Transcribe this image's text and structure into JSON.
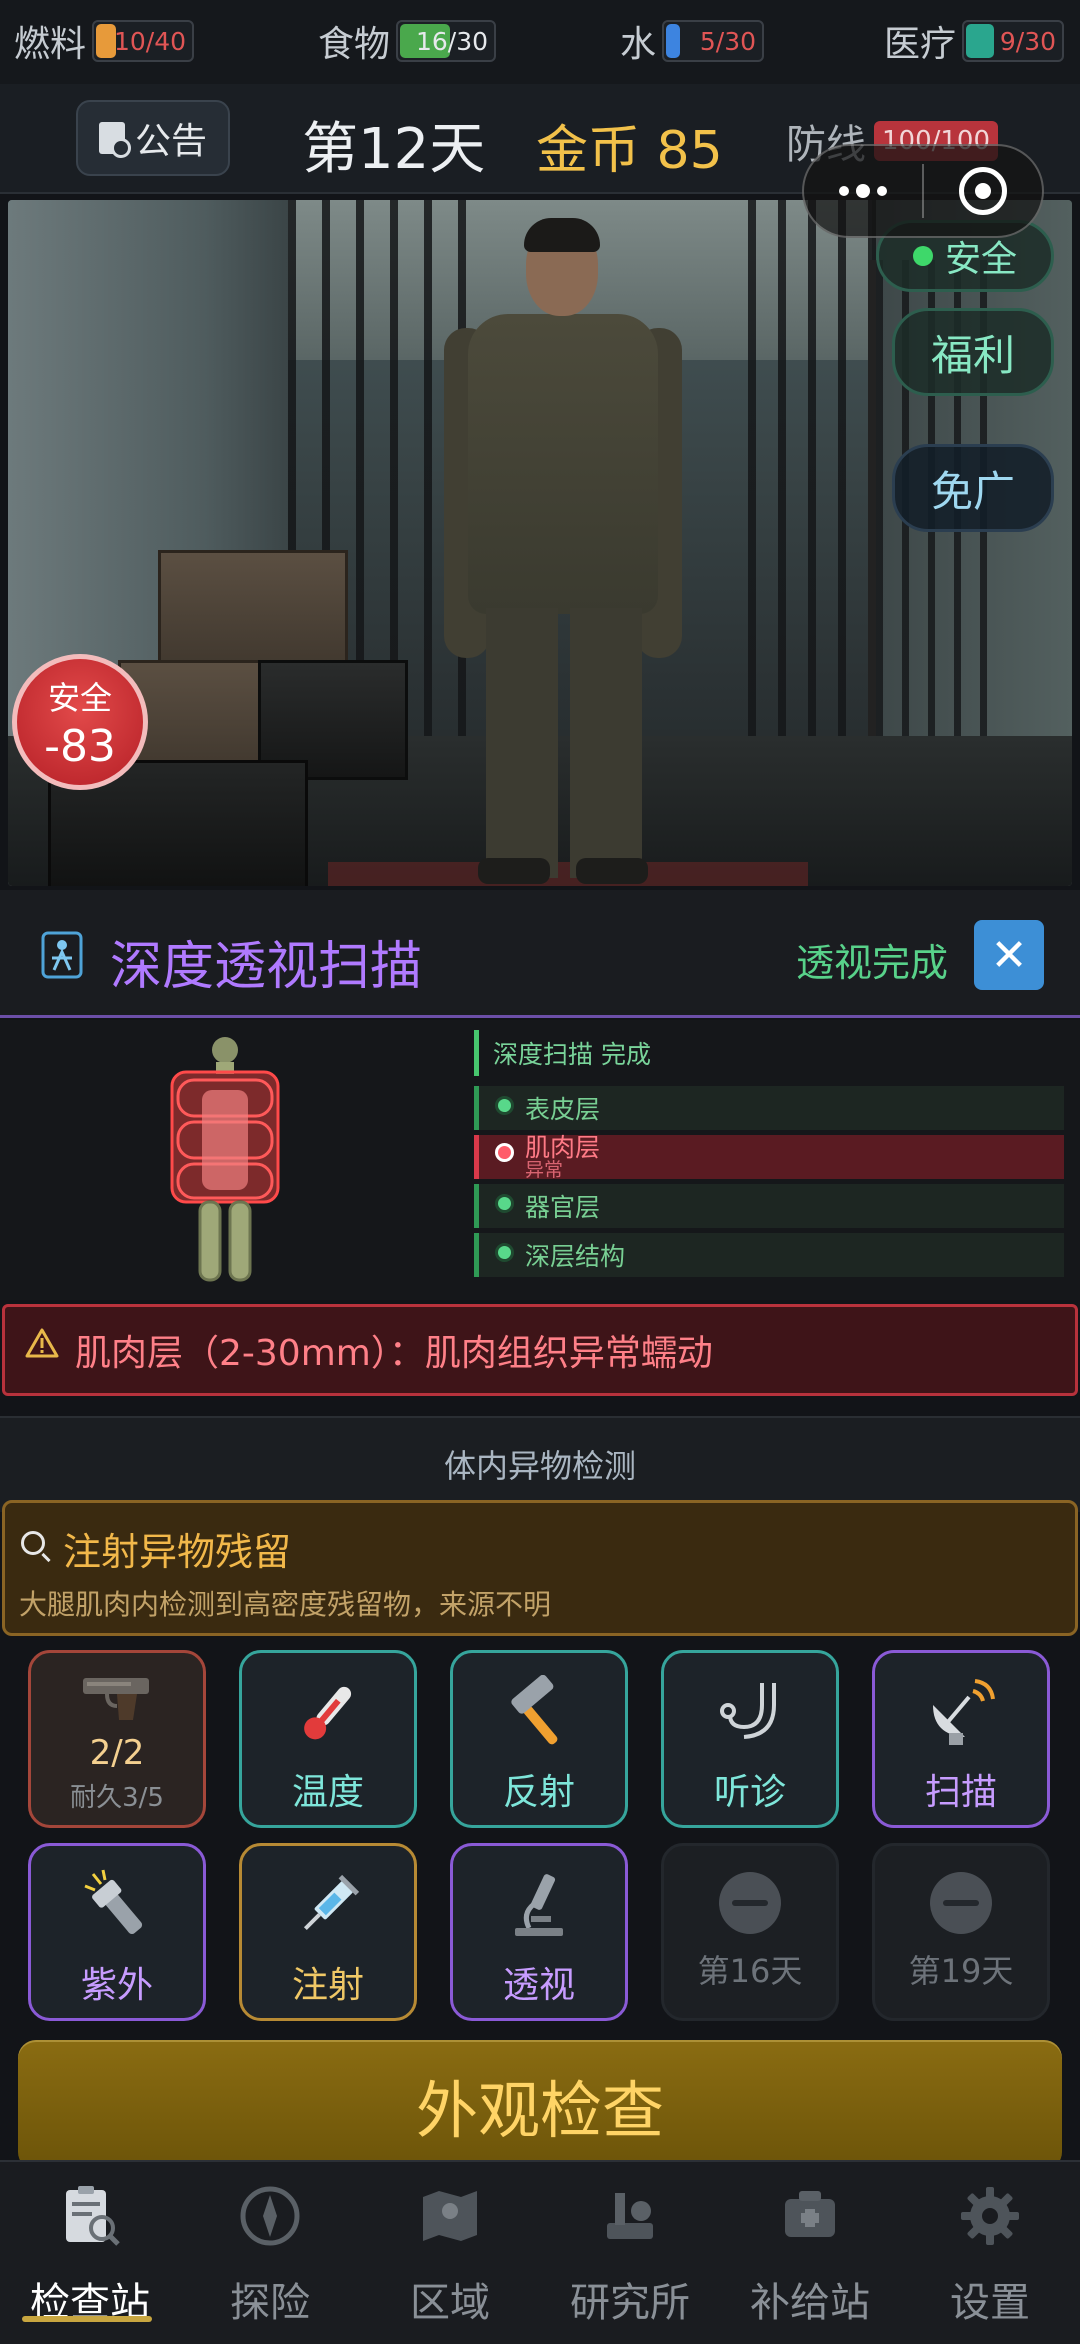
{
  "resources": [
    {
      "label": "燃料",
      "value": "10/40",
      "color": "#e79a3a",
      "value_color": "#e05555"
    },
    {
      "label": "食物",
      "value": "16/30",
      "color": "#4aa84c",
      "value_color": "#e6e9ec"
    },
    {
      "label": "水",
      "value": "5/30",
      "color": "#3d84e0",
      "value_color": "#e05555"
    },
    {
      "label": "医疗",
      "value": "9/30",
      "color": "#2aa68e",
      "value_color": "#e05555"
    }
  ],
  "status": {
    "notice_label": "公告",
    "day": "第12天",
    "gold": "金币 85",
    "defense_label": "防线",
    "defense_value": "100/100"
  },
  "scene": {
    "safe_chip": "安全",
    "welfare_button": "福利",
    "no_ads_button": "免广",
    "danger_label": "安全",
    "danger_value": "-83"
  },
  "scan": {
    "title": "深度透视扫描",
    "status": "透视完成",
    "close": "✕",
    "header": "深度扫描 完成",
    "layers": [
      {
        "name": "表皮层",
        "state": "normal"
      },
      {
        "name": "肌肉层",
        "sub": "异常",
        "state": "alert"
      },
      {
        "name": "器官层",
        "state": "normal"
      },
      {
        "name": "深层结构",
        "state": "normal"
      }
    ]
  },
  "alert": {
    "text": "肌肉层（2-30mm）：肌肉组织异常蠕动"
  },
  "section_title": "体内异物检测",
  "finding": {
    "name": "注射异物残留",
    "desc": "大腿肌肉内检测到高密度残留物，来源不明"
  },
  "tools": [
    {
      "id": "pistol",
      "count": "2/2",
      "durability": "耐久3/5",
      "icon": "pistol-icon"
    },
    {
      "id": "temperature",
      "label": "温度",
      "icon": "thermometer-icon"
    },
    {
      "id": "reflex",
      "label": "反射",
      "icon": "hammer-icon"
    },
    {
      "id": "auscultation",
      "label": "听诊",
      "icon": "stethoscope-icon"
    },
    {
      "id": "scan",
      "label": "扫描",
      "icon": "satellite-dish-icon"
    },
    {
      "id": "uv",
      "label": "紫外",
      "icon": "flashlight-icon"
    },
    {
      "id": "inject",
      "label": "注射",
      "icon": "syringe-icon"
    },
    {
      "id": "xray",
      "label": "透视",
      "icon": "microscope-icon"
    },
    {
      "id": "locked16",
      "label": "第16天",
      "icon": "locked-minus-icon"
    },
    {
      "id": "locked19",
      "label": "第19天",
      "icon": "locked-minus-icon"
    }
  ],
  "main_action": "外观检查",
  "nav": [
    {
      "label": "检查站",
      "icon": "checkpoint-icon",
      "active": true
    },
    {
      "label": "探险",
      "icon": "compass-icon"
    },
    {
      "label": "区域",
      "icon": "map-icon"
    },
    {
      "label": "研究所",
      "icon": "lab-icon"
    },
    {
      "label": "补给站",
      "icon": "supply-icon"
    },
    {
      "label": "设置",
      "icon": "gear-icon"
    }
  ]
}
